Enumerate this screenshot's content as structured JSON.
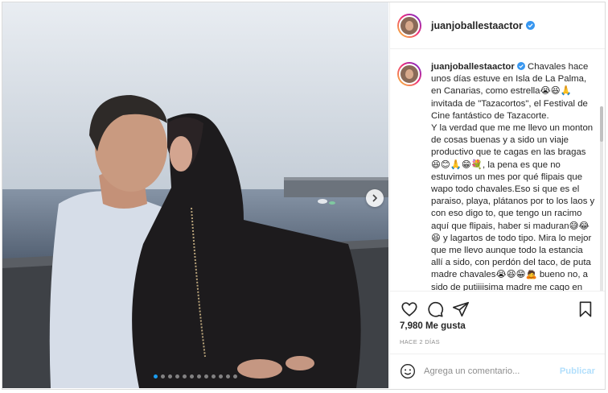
{
  "post": {
    "photo_alt": "",
    "carousel": {
      "count": 12,
      "active_index": 0
    }
  },
  "header": {
    "username": "juanjoballestaactor",
    "verified": true
  },
  "caption": {
    "username": "juanjoballestaactor",
    "text": " Chavales hace unos días estuve en Isla de La Palma, en Canarias, como estrella😭😆🙏 invitada de \"Tazacortos\", el Festival de Cine fantástico de Tazacorte.\nY la verdad que me me llevo un monton de cosas buenas y a sido un viaje productivo que te cagas en las bragas😆😊🙏😁💐, la pena es que no estuvimos un mes por qué flipais que wapo todo chavales.Eso si que es el paraiso, playa, plátanos por to los laos y con eso digo to, que tengo un racimo aquí que flipais, haber si maduran😅😂😆 y lagartos de todo tipo. Mira lo mejor que me llevo aunque todo la estancia allí a sido, con perdón del taco, de puta madre chavales😭😆😁🙇 bueno no, a sido de putiiiisima madre me cago en"
  },
  "actions": {
    "like_icon": "heart-icon",
    "comment_icon": "comment-icon",
    "share_icon": "paper-plane-icon",
    "save_icon": "bookmark-icon"
  },
  "likes": "7,980 Me gusta",
  "timestamp": "HACE 2 DÍAS",
  "comment_box": {
    "placeholder": "Agrega un comentario...",
    "publish_label": "Publicar",
    "emoji_icon": "smiley-icon"
  },
  "colors": {
    "verified_blue": "#3897f0",
    "publish_disabled": "#b2dffc",
    "border": "#dbdbdb"
  }
}
